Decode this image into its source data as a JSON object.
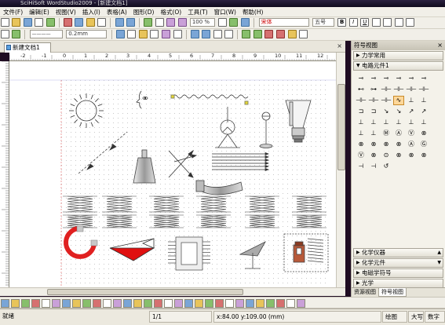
{
  "app": {
    "title": "SciHiSoft WordStudio2009 - [新建文档1]"
  },
  "menu": [
    "文件(F)",
    "编辑(E)",
    "视图(V)",
    "插入(I)",
    "表格(A)",
    "图形(D)",
    "格式(O)",
    "工具(T)",
    "窗口(W)",
    "帮助(H)"
  ],
  "toolbar": {
    "zoom": "100 %",
    "font_name": "宋体",
    "font_size": "五号",
    "bold": "B",
    "italic": "I",
    "underline": "U",
    "line_width": "0.2mm"
  },
  "document_tab": {
    "label": "新建文档1",
    "close": "×"
  },
  "ruler": {
    "h_ticks": [
      "-2",
      "-1",
      "0",
      "1",
      "2",
      "3",
      "4",
      "5",
      "6",
      "7",
      "8",
      "9",
      "10",
      "11",
      "12",
      "13",
      "14"
    ]
  },
  "symbol_panel": {
    "title": "符号视图",
    "close": "×",
    "categories_top": [
      {
        "label": "力学常用",
        "expanded": false
      },
      {
        "label": "电路元件1",
        "expanded": true
      }
    ],
    "symbols": [
      "⊸",
      "⊸",
      "⊸",
      "⊸",
      "⊸",
      "⊸",
      "⊷",
      "⊶",
      "⊣⊢",
      "⊣⊢",
      "⊣⊢",
      "⊣⊢",
      "⊣⊢",
      "⊣⊢",
      "⊣⊢",
      "∿",
      "⊥",
      "⊥",
      "⊐",
      "⊐",
      "↘",
      "↘",
      "↗",
      "↗",
      "⊥",
      "⊥",
      "⊥",
      "⊥",
      "⊥",
      "⊥",
      "⊥",
      "⊥",
      "Ⓜ",
      "Ⓐ",
      "Ⓥ",
      "⊗",
      "⊗",
      "⊗",
      "⊗",
      "⊗",
      "Ⓐ",
      "Ⓖ",
      "Ⓥ",
      "⊗",
      "⊙",
      "⊗",
      "⊗",
      "⊗",
      "⊣",
      "⊣",
      "↺"
    ],
    "categories_bottom": [
      {
        "label": "化学仪器"
      },
      {
        "label": "化学元件"
      },
      {
        "label": "电磁学符号"
      },
      {
        "label": "光学"
      }
    ],
    "tabs": [
      {
        "label": "资源视图",
        "active": false
      },
      {
        "label": "符号视图",
        "active": true
      }
    ]
  },
  "status": {
    "left": "就绪",
    "page": "1/1",
    "coords": "x:84.00  y:109.00  (mm)",
    "mode": "绘图",
    "caps": "大写",
    "num": "数字"
  }
}
